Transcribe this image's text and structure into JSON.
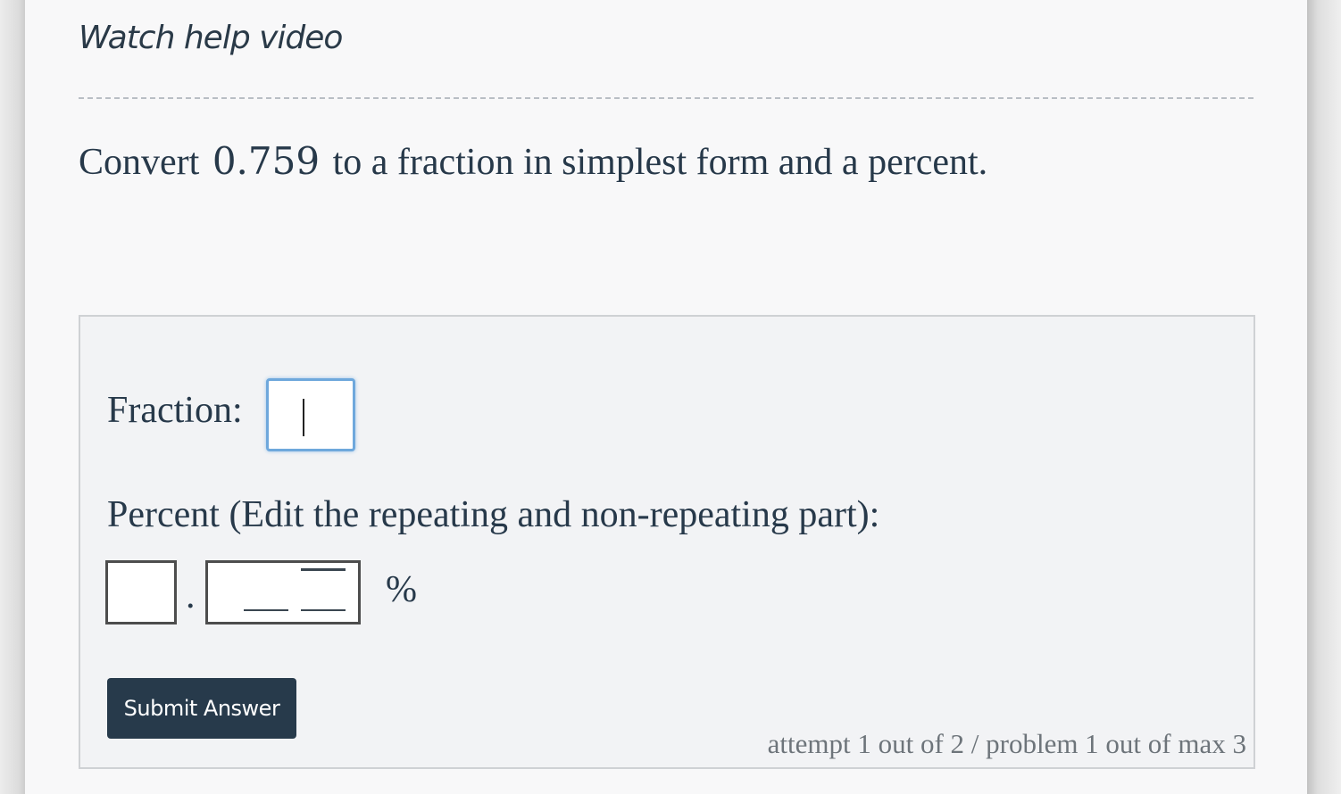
{
  "header": {
    "help_link": "Watch help video"
  },
  "question": {
    "prefix": "Convert",
    "value": "0.759",
    "suffix": "to a fraction in simplest form and a percent."
  },
  "answer": {
    "fraction_label": "Fraction:",
    "fraction_value": "",
    "percent_label": "Percent (Edit the repeating and non-repeating part):",
    "percent_whole_value": "",
    "decimal_point": ".",
    "percent_sign": "%",
    "submit_label": "Submit Answer"
  },
  "status": {
    "attempt_text": "attempt 1 out of 2 / problem 1 out of max 3"
  },
  "colors": {
    "primary_text": "#27394a",
    "button_bg": "#273a4b",
    "focus_border": "#6fa8dc"
  }
}
